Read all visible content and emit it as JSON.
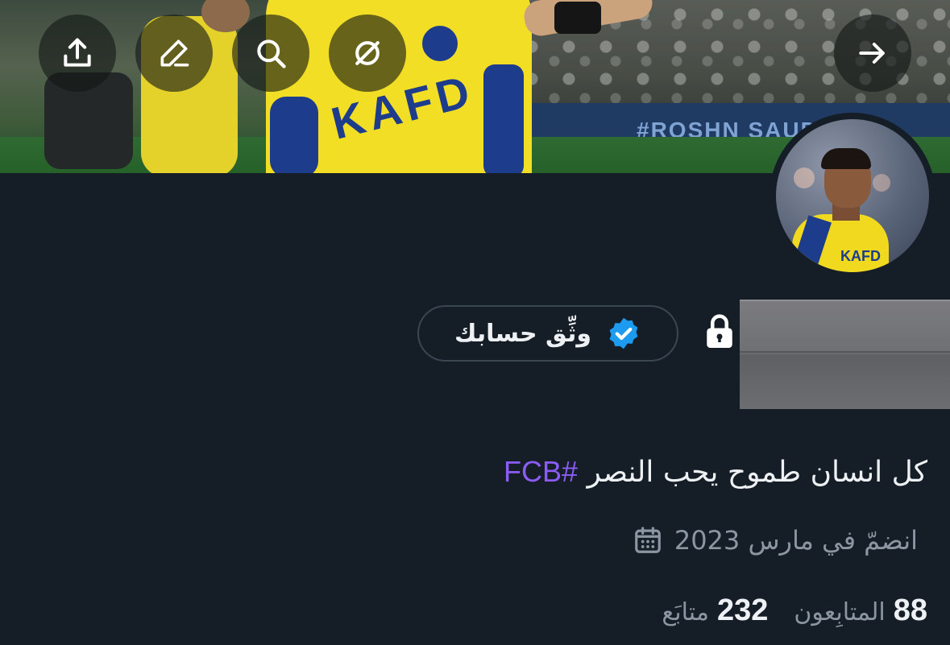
{
  "header": {
    "banner_sponsor_text": "KAFD",
    "board_text": "#ROSHN SAUDI"
  },
  "toolbar": {
    "share_icon": "share-upload-icon",
    "edit_icon": "edit-pencil-icon",
    "search_icon": "search-icon",
    "remove_icon": "circle-slash-icon",
    "back_icon": "arrow-right-icon"
  },
  "profile": {
    "verify_button_label": "وثِّق حسابك",
    "verify_badge_color": "#1d9bf0",
    "bio_text": "كل انسان طموح يحب النصر",
    "bio_hashtag": "#FCB",
    "hashtag_color": "#8b5cf6",
    "joined_text": "انضمّ في مارس 2023",
    "following_count": "232",
    "following_label": "متابَع",
    "followers_count": "88",
    "followers_label": "المتابِعون"
  },
  "colors": {
    "background": "#151d27",
    "text_primary": "#eef1f4",
    "text_secondary": "#8b96a2"
  }
}
